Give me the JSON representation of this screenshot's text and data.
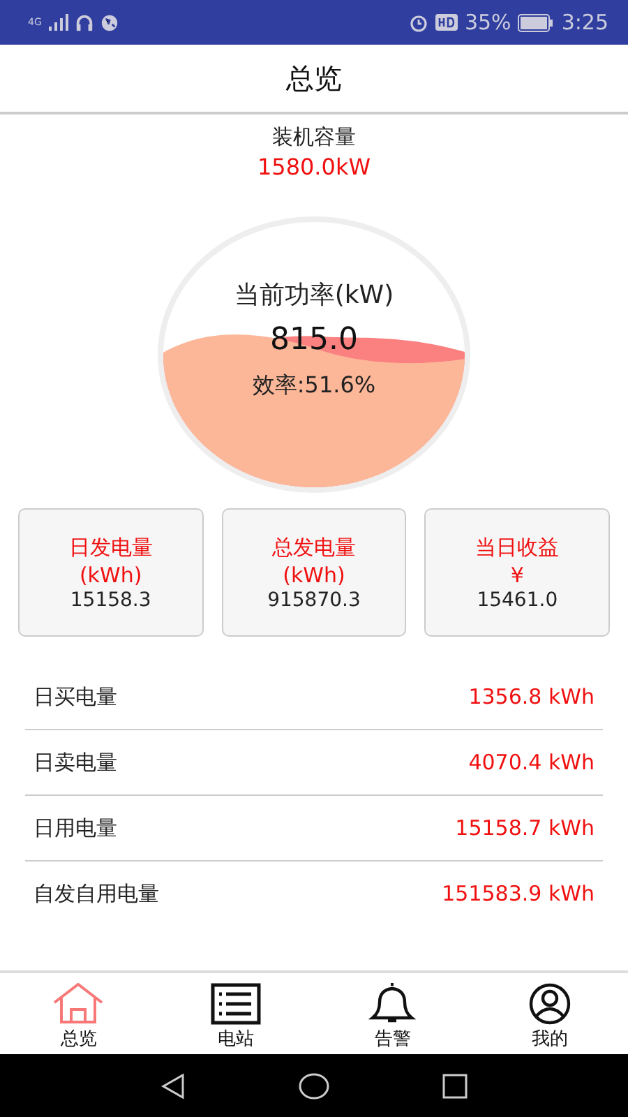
{
  "status_bar": {
    "network": "4G",
    "battery": "35%",
    "time": "3:25"
  },
  "header": {
    "title": "总览"
  },
  "capacity": {
    "label": "装机容量",
    "value": "1580.0kW"
  },
  "gauge": {
    "title": "当前功率(kW)",
    "value": "815.0",
    "efficiency": "效率:51.6%"
  },
  "cards": [
    {
      "label": "日发电量",
      "unit": "(kWh)",
      "value": "15158.3"
    },
    {
      "label": "总发电量",
      "unit": "(kWh)",
      "value": "915870.3"
    },
    {
      "label": "当日收益",
      "unit": "¥",
      "value": "15461.0"
    }
  ],
  "rows": [
    {
      "label": "日买电量",
      "value": "1356.8 kWh"
    },
    {
      "label": "日卖电量",
      "value": "4070.4 kWh"
    },
    {
      "label": "日用电量",
      "value": "15158.7 kWh"
    },
    {
      "label": "自发自用电量",
      "value": "151583.9 kWh"
    }
  ],
  "tabs": [
    {
      "label": "总览",
      "selected": true
    },
    {
      "label": "电站",
      "selected": false
    },
    {
      "label": "告警",
      "selected": false
    },
    {
      "label": "我的",
      "selected": false
    }
  ]
}
